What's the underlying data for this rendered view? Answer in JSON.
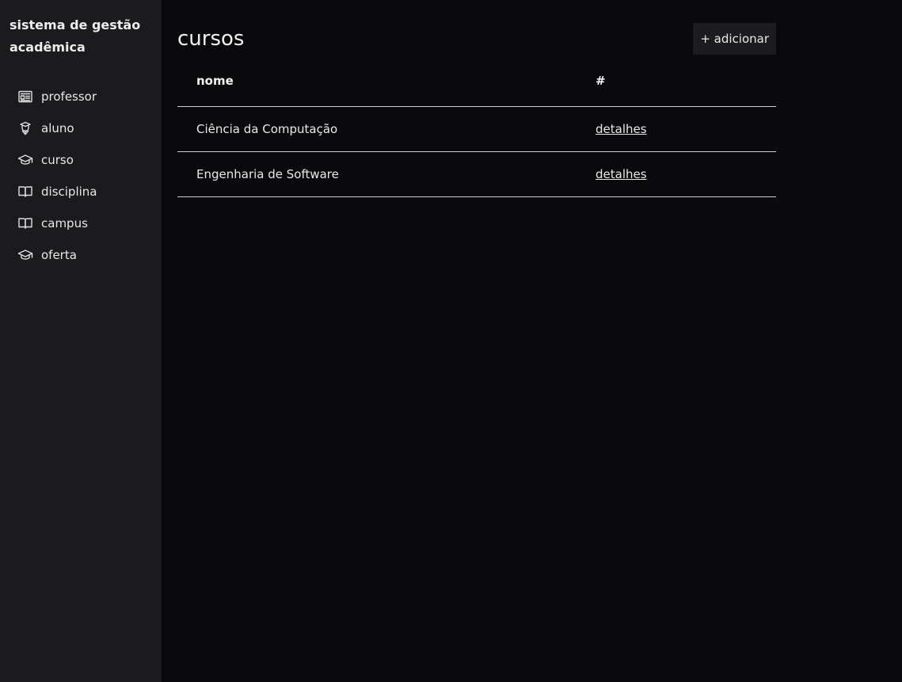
{
  "sidebar": {
    "brand_line1": "sistema de gestão",
    "brand_line2": "acadêmica",
    "items": [
      {
        "label": "professor",
        "icon": "id-card-icon"
      },
      {
        "label": "aluno",
        "icon": "student-icon"
      },
      {
        "label": "curso",
        "icon": "graduation-cap-icon"
      },
      {
        "label": "disciplina",
        "icon": "book-open-icon"
      },
      {
        "label": "campus",
        "icon": "book-open-icon"
      },
      {
        "label": "oferta",
        "icon": "graduation-cap-icon"
      }
    ]
  },
  "main": {
    "title": "cursos",
    "add_label": "+ adicionar",
    "table": {
      "headers": [
        "nome",
        "#"
      ],
      "rows": [
        {
          "name": "Ciência da Computação",
          "action": "detalhes"
        },
        {
          "name": "Engenharia de Software",
          "action": "detalhes"
        }
      ]
    }
  },
  "colors": {
    "sidebar_bg": "#1b1b1d",
    "main_bg": "#0a0a0c",
    "text": "#e8e8e8",
    "button_bg": "#1c1c1e"
  }
}
